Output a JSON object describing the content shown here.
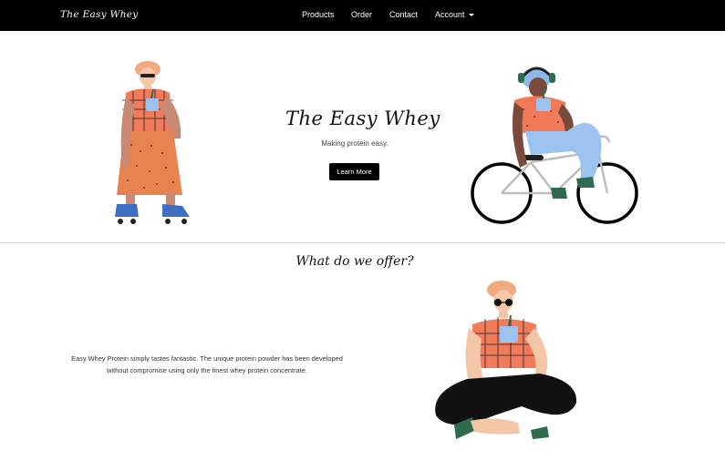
{
  "navbar": {
    "brand": "The Easy Whey",
    "links": [
      "Products",
      "Order",
      "Contact",
      "Account"
    ]
  },
  "hero": {
    "title": "The Easy Whey",
    "subtitle": "Making protein easy.",
    "button_label": "Learn More"
  },
  "offer": {
    "title": "What do we offer?",
    "description": "Easy Whey Protein simply tastes fantastic. The unique protein powder has been developed without compromise using only the finest whey protein concentrate."
  },
  "icons": [
    "caret-down-icon",
    "skater-illustration",
    "cyclist-illustration",
    "sitting-person-illustration"
  ],
  "colors": {
    "navbar_bg": "#000000",
    "accent_orange": "#f07a5a",
    "accent_blue": "#8fb8e8",
    "button_bg": "#000000"
  }
}
